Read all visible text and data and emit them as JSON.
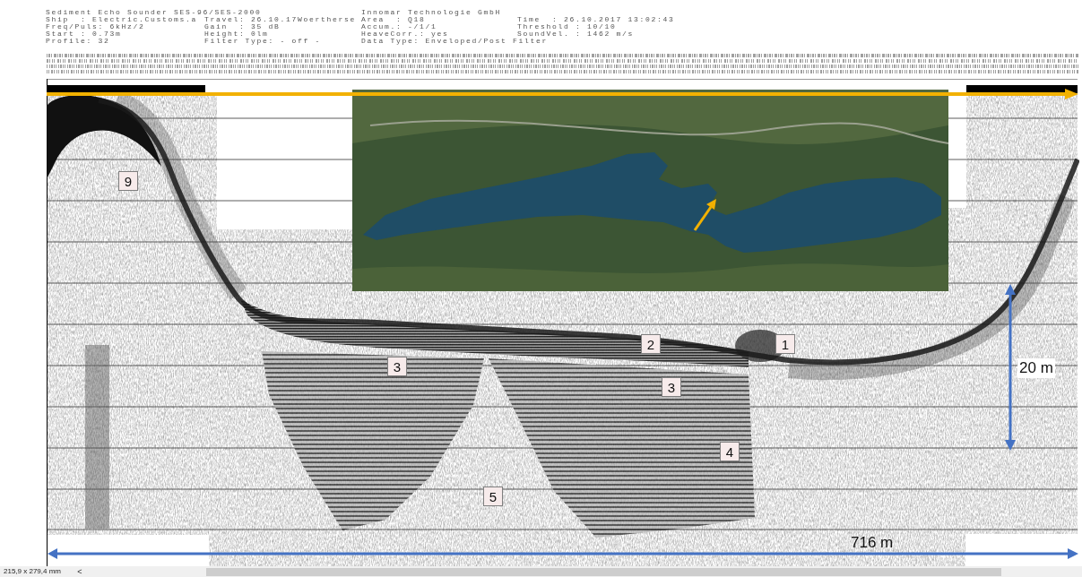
{
  "header": {
    "title": "Sediment Echo Sounder SES-96/SES-2000",
    "vendor": "Innomar Technologie GmbH",
    "rows": [
      [
        "Ship  : Electric.Customs.a",
        "Travel: 26.10.17Woertherse",
        "Area  : Q18",
        "Time  : 26.10.2017 13:02:43"
      ],
      [
        "Freq/Puls: 6kHz/2",
        "Gain  : 35 dB",
        "Accum.: -/1/1",
        "Threshold : 10/10"
      ],
      [
        "Start : 0.73m",
        "Height: 0lm",
        "HeaveCorr.: yes",
        "SoundVel. : 1462 m/s"
      ],
      [
        "Profile: 32",
        "Filter Type: - off -",
        "Data Type: Enveloped/Post Filter"
      ]
    ]
  },
  "echogram": {
    "markers": [
      {
        "label": "9"
      },
      {
        "label": "2"
      },
      {
        "label": "1"
      },
      {
        "label": "3"
      },
      {
        "label": "3"
      },
      {
        "label": "4"
      },
      {
        "label": "5"
      }
    ],
    "depth_scale": "20 m",
    "distance_scale": "716 m"
  },
  "status_bar": {
    "page_size": "215,9 x 279,4 mm",
    "scroll_left": "<"
  }
}
